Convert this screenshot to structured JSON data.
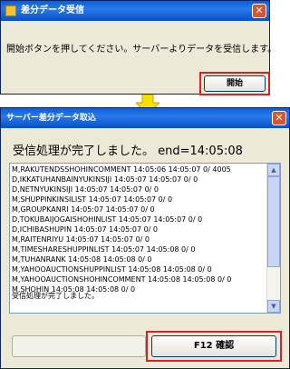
{
  "window1": {
    "title": "差分データ受信",
    "message": "開始ボタンを押してください。サーバーよりデータを受信します。",
    "start_button": "開始",
    "close_glyph": "✕"
  },
  "window2": {
    "title": "サーバー差分データ取込",
    "heading": "受信処理が完了しました。 end=14:05:08",
    "log_lines": [
      "M,RAKUTENDSSHOHINCOMMENT 14:05:06 14:05:07 0/ 4005",
      "D,IKKATUHANBAINYUKINSIJI 14:05:07 14:05:07 0/ 0",
      "D,NETNYUKINSIJI 14:05:07 14:05:07 0/ 0",
      "M,SHUPPINKINSILIST 14:05:07 14:05:07 0/ 0",
      "M,GROUPKANRI 14:05:07 14:05:07 0/ 0",
      "D,TOKUBAIJOGAISHOHINLIST 14:05:07 14:05:07 0/ 0",
      "D,ICHIBASHUPIN 14:05:07 14:05:07 0/ 0",
      "M,RAITENRIYU 14:05:07 14:05:07 0/ 0",
      "M,TIMESHARESHUPPINLIST 14:05:07 14:05:08 0/ 0",
      "M,TUHANRANK 14:05:08 14:05:08 0/ 0",
      "M,YAHOOAUCTIONSHUPPINLIST 14:05:08 14:05:08 0/ 0",
      "M,YAHOOAUCTIONSHOHINCOMMENT 14:05:08 14:05:08 0/ 0",
      "M,SHOHIN 14:05:08 14:05:08 0/ 0"
    ],
    "log_done": "受信処理が完了しました。",
    "confirm_button": "F12 確認"
  },
  "colors": {
    "titlebar": "#0a5fd8",
    "highlight": "#e02020",
    "arrow": "#f5e000"
  }
}
